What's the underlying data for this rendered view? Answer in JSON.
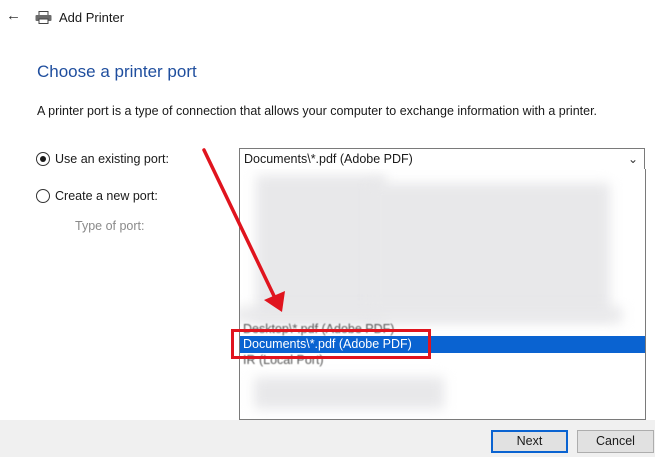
{
  "window": {
    "title": "Add Printer",
    "back_icon": "back-arrow-icon",
    "app_icon": "printer-icon"
  },
  "heading": "Choose a printer port",
  "description": "A printer port is a type of connection that allows your computer to exchange information with a printer.",
  "options": {
    "existing": {
      "label": "Use an existing port:",
      "checked": true
    },
    "new": {
      "label": "Create a new port:",
      "checked": false
    },
    "type_label": "Type of port:"
  },
  "port_select": {
    "value": "Documents\\*.pdf (Adobe PDF)",
    "chevron_icon": "chevron-down-icon"
  },
  "port_list": [
    {
      "label": "Desktop\\*.pdf (Adobe PDF)",
      "selected": false
    },
    {
      "label": "Documents\\*.pdf (Adobe PDF)",
      "selected": true
    },
    {
      "label": "IR (Local Port)",
      "selected": false
    }
  ],
  "buttons": {
    "next": "Next",
    "cancel": "Cancel"
  },
  "colors": {
    "heading": "#1f4e9e",
    "selection": "#0a63d1",
    "annotation": "#e0141e"
  }
}
